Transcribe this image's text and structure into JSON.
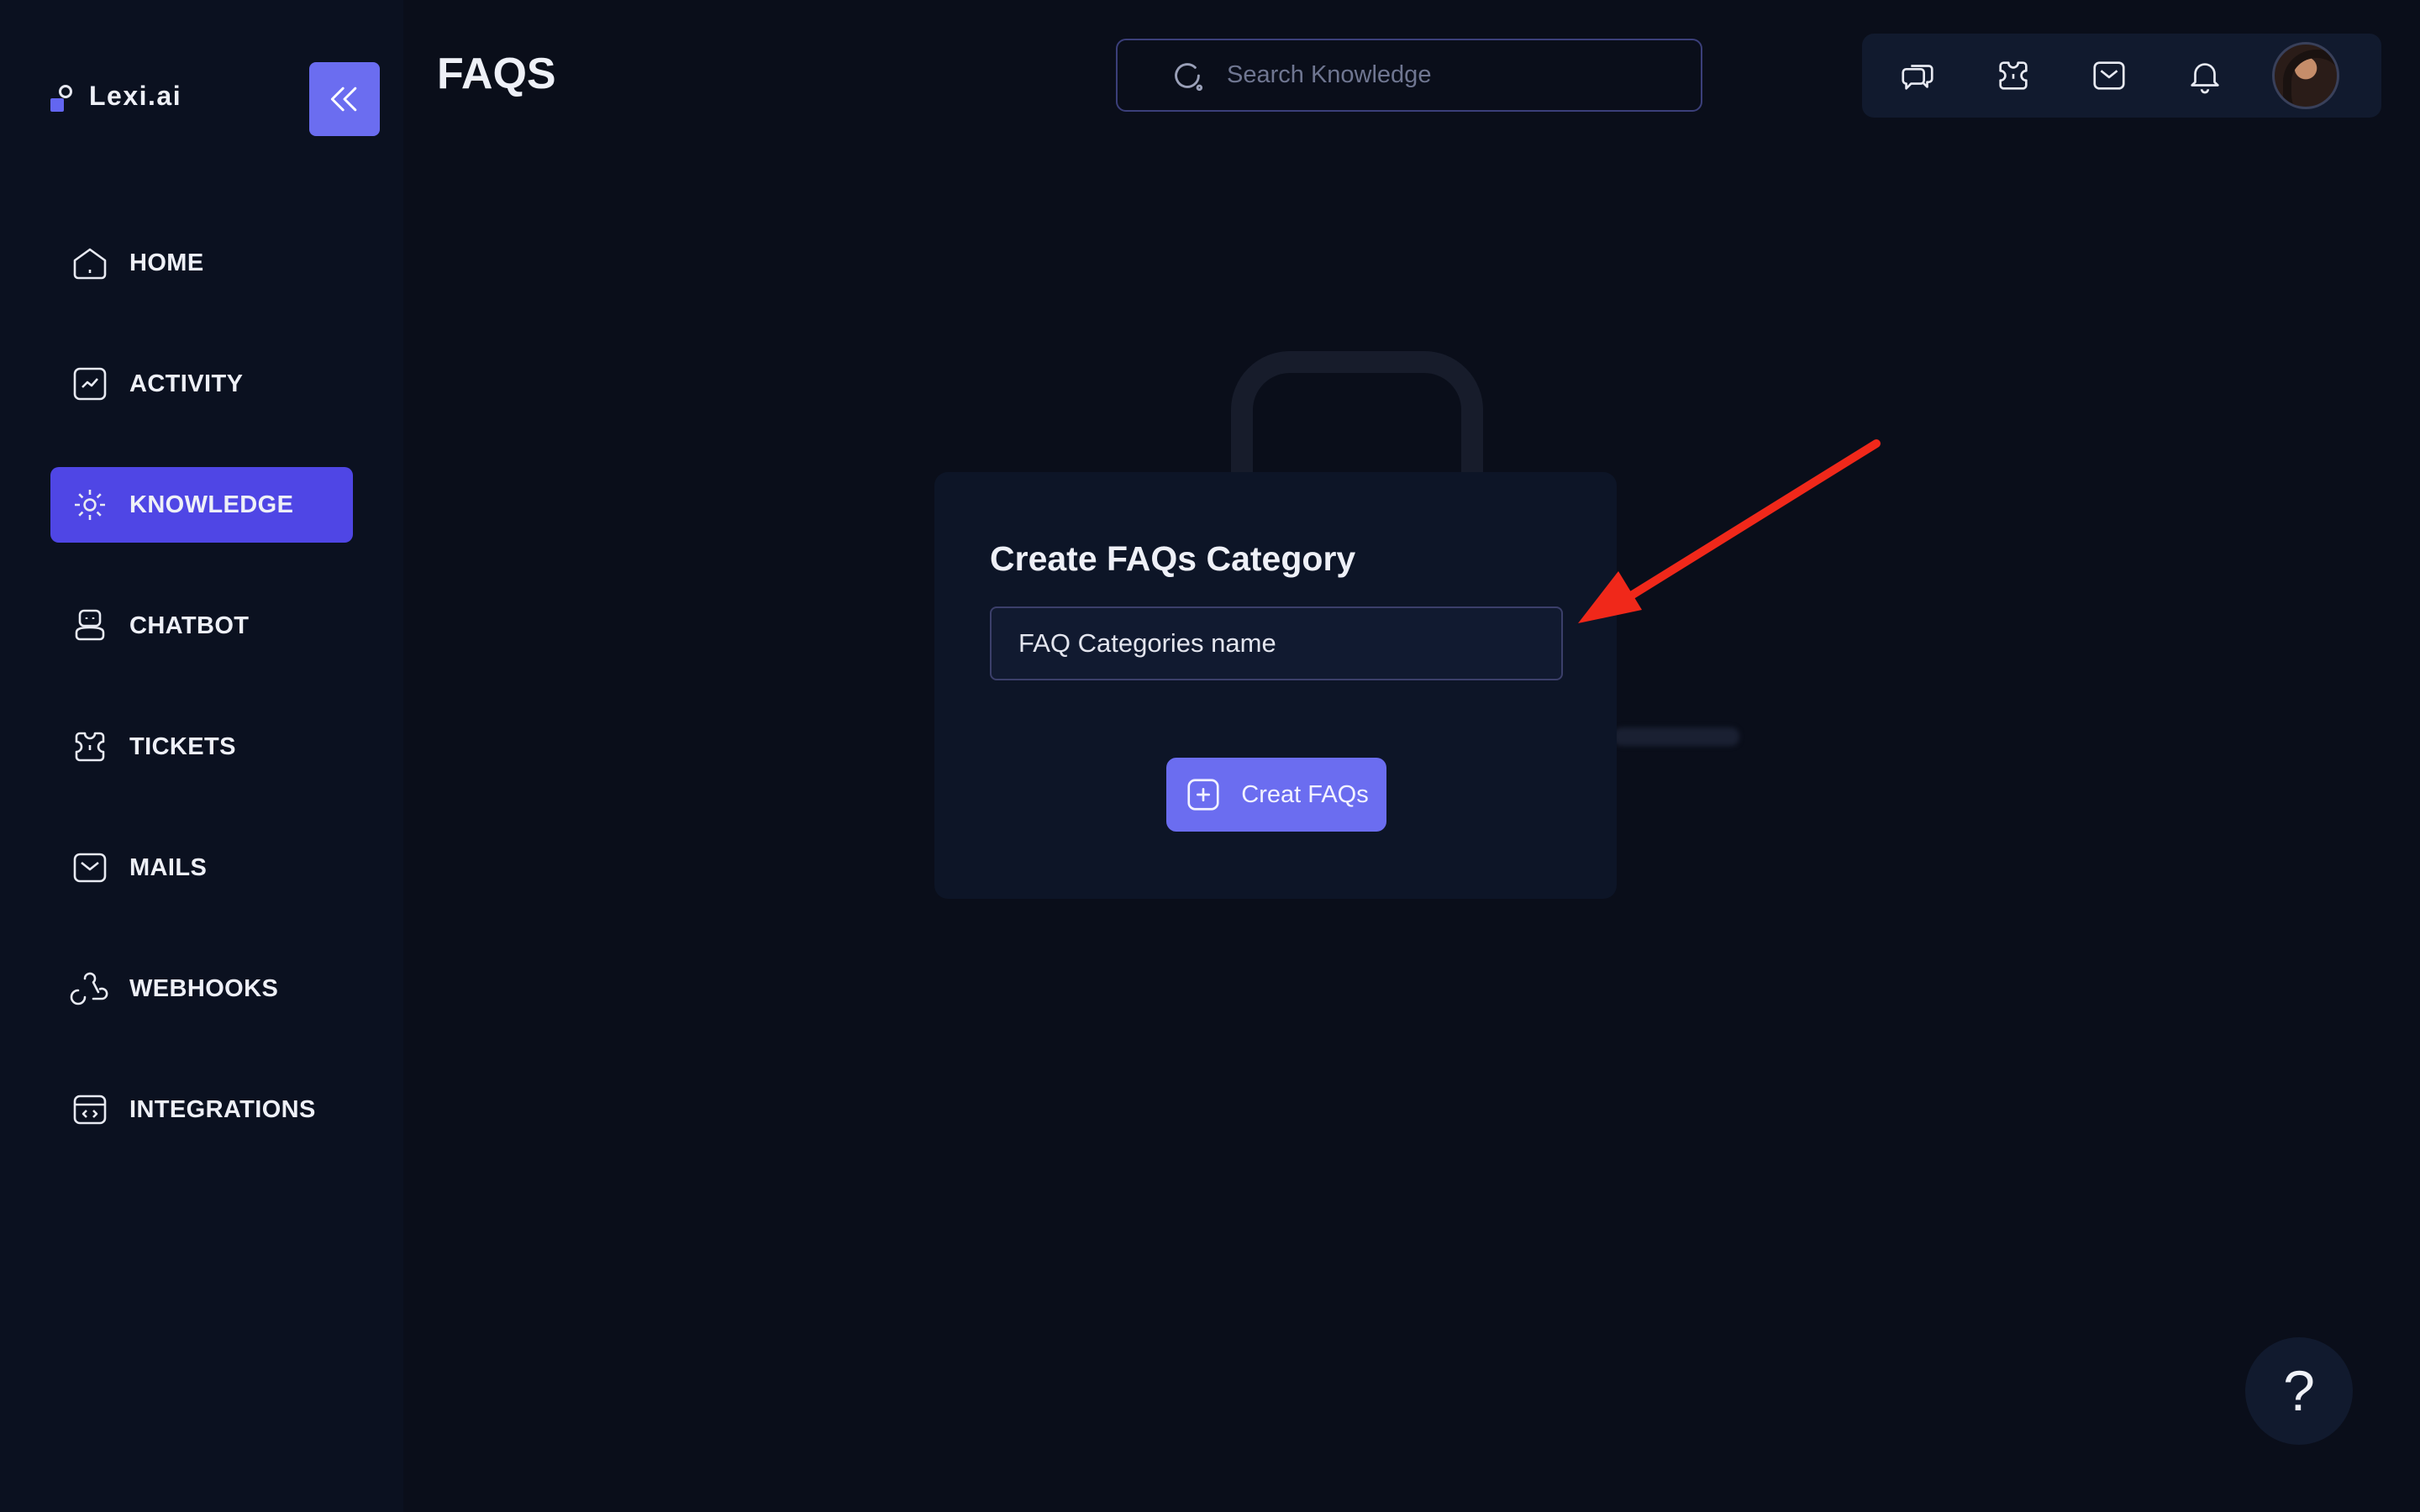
{
  "brand": {
    "name": "Lexi.ai"
  },
  "header": {
    "title": "FAQS",
    "search_placeholder": "Search Knowledge",
    "top_icons": [
      "chat-bubbles-icon",
      "ticket-icon",
      "mail-icon",
      "bell-icon"
    ]
  },
  "sidebar": {
    "items": [
      {
        "label": "HOME",
        "icon": "home-icon",
        "active": false
      },
      {
        "label": "ACTIVITY",
        "icon": "activity-icon",
        "active": false
      },
      {
        "label": "KNOWLEDGE",
        "icon": "knowledge-icon",
        "active": true
      },
      {
        "label": "CHATBOT",
        "icon": "chatbot-icon",
        "active": false
      },
      {
        "label": "TICKETS",
        "icon": "ticket-icon",
        "active": false
      },
      {
        "label": "MAILS",
        "icon": "mail-icon",
        "active": false
      },
      {
        "label": "WEBHOOKS",
        "icon": "webhook-icon",
        "active": false
      },
      {
        "label": "INTEGRATIONS",
        "icon": "integrations-icon",
        "active": false
      }
    ]
  },
  "modal": {
    "title": "Create FAQs Category",
    "input_placeholder": "FAQ Categories name",
    "button_label": "Creat FAQs"
  },
  "help": {
    "label": "?"
  },
  "colors": {
    "accent": "#6b6df0",
    "active_nav": "#4f46e5",
    "background": "#0a0e1a",
    "sidebar": "#0b1120",
    "annotation_arrow": "#f0281a"
  }
}
